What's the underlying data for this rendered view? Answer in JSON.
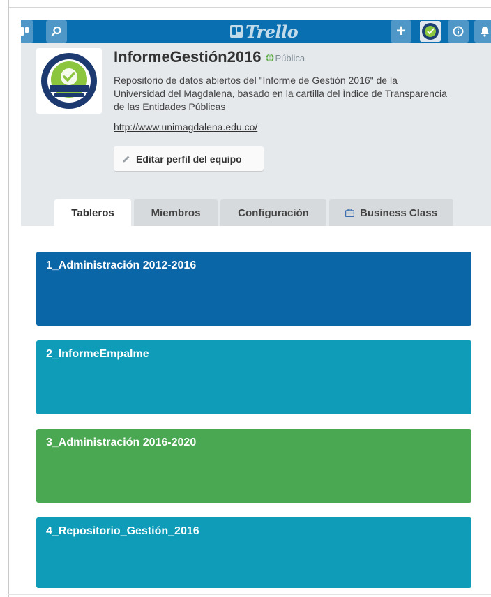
{
  "topbar": {
    "logo_text": "Trello",
    "plus_label": "+",
    "color": "#0a6fb0"
  },
  "team": {
    "name": "InformeGestión2016",
    "visibility": "Pública",
    "description": "Repositorio de datos abiertos del \"Informe de Gestión 2016\" de la Universidad del Magdalena, basado en la cartilla del Índice de Transparencia de las Entidades Públicas",
    "website": "http://www.unimagdalena.edu.co/",
    "edit_label": "Editar perfil del equipo"
  },
  "tabs": [
    {
      "label": "Tableros",
      "active": true
    },
    {
      "label": "Miembros",
      "active": false
    },
    {
      "label": "Configuración",
      "active": false
    },
    {
      "label": "Business Class",
      "active": false,
      "icon": "briefcase-icon"
    }
  ],
  "boards": [
    {
      "title": "1_Administración 2012-2016",
      "color": "#0b66a8"
    },
    {
      "title": "2_InformeEmpalme",
      "color": "#0e9cb9"
    },
    {
      "title": "3_Administración 2016-2020",
      "color": "#4aa852"
    },
    {
      "title": "4_Repositorio_Gestión_2016",
      "color": "#0e9cb9"
    }
  ]
}
